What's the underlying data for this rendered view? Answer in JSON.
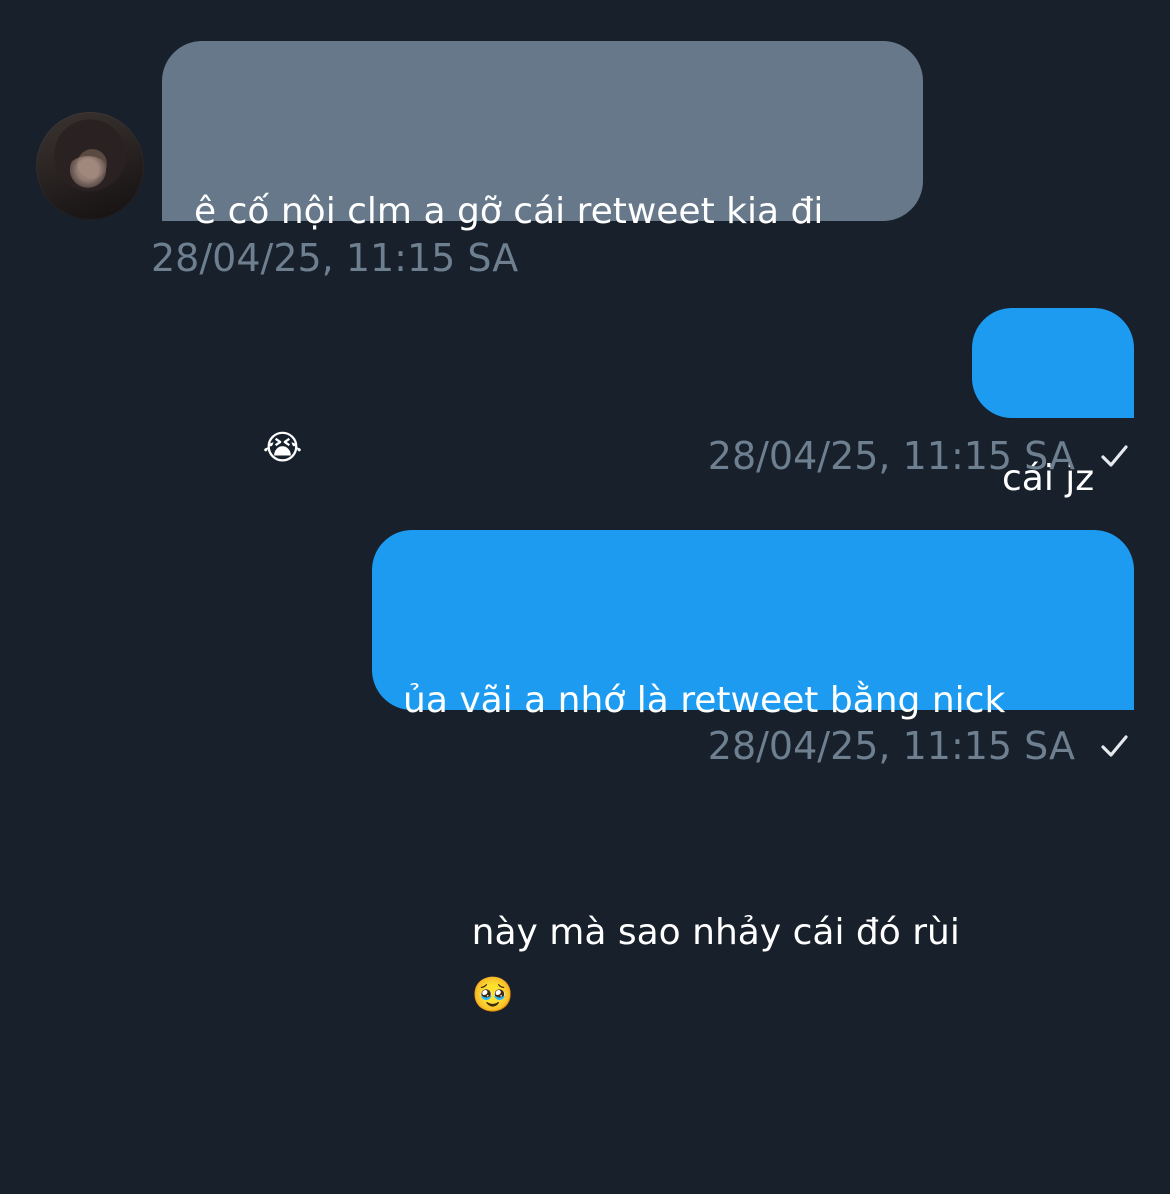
{
  "conversation": {
    "messages": [
      {
        "direction": "incoming",
        "text_line_1": "ê cố nội clm a gỡ cái retweet kia đi",
        "emoji": "😭",
        "timestamp": "28/04/25, 11:15 SA"
      },
      {
        "direction": "outgoing",
        "text": "cái jz",
        "timestamp": "28/04/25, 11:15 SA",
        "status_icon": "check-icon"
      },
      {
        "direction": "outgoing",
        "text_line_1": "ủa vãi a nhớ là retweet bằng nick",
        "text_line_2": "này mà sao nhảy cái đó rùi",
        "emoji": "🥹",
        "timestamp": "28/04/25, 11:15 SA",
        "status_icon": "check-icon"
      }
    ]
  },
  "colors": {
    "background": "#17202b",
    "incoming_bubble": "#66788a",
    "outgoing_bubble": "#1d9bf0",
    "timestamp": "#6e7f90",
    "check": "#e6e9ed"
  }
}
